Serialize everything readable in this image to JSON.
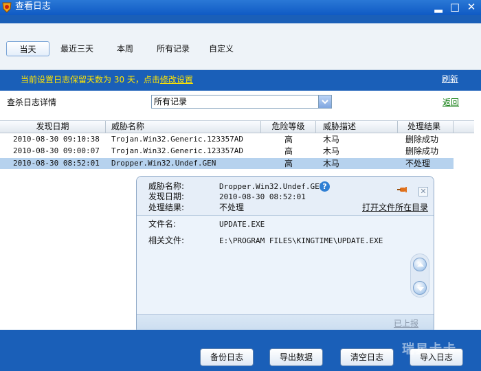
{
  "window": {
    "title": "查看日志",
    "minimize_glyph": "▂",
    "maximize_glyph": "□",
    "close_glyph": "✕"
  },
  "tabs": [
    {
      "label": "当天",
      "active": true
    },
    {
      "label": "最近三天",
      "active": false
    },
    {
      "label": "本周",
      "active": false
    },
    {
      "label": "所有记录",
      "active": false
    },
    {
      "label": "自定义",
      "active": false
    }
  ],
  "notice": {
    "text": "当前设置日志保留天数为 30 天，点击",
    "link": "修改设置",
    "color": "#ffe400"
  },
  "refresh_label": "刷新",
  "filter": {
    "label": "查杀日志详情",
    "selected": "所有记录"
  },
  "back_label": "返回",
  "table": {
    "columns": [
      "发现日期",
      "威胁名称",
      "危险等级",
      "威胁描述",
      "处理结果"
    ],
    "rows": [
      [
        "2010-08-30 09:10:38",
        "Trojan.Win32.Generic.123357AD",
        "高",
        "木马",
        "删除成功"
      ],
      [
        "2010-08-30 09:00:07",
        "Trojan.Win32.Generic.123357AD",
        "高",
        "木马",
        "删除成功"
      ],
      [
        "2010-08-30 08:52:01",
        "Dropper.Win32.Undef.GEN",
        "高",
        "木马",
        "不处理"
      ]
    ],
    "selected_row": 2
  },
  "detail": {
    "threat_name_label": "威胁名称:",
    "threat_name": "Dropper.Win32.Undef.GEN",
    "found_date_label": "发现日期:",
    "found_date": "2010-08-30 08:52:01",
    "result_label": "处理结果:",
    "result": "不处理",
    "open_dir_link": "打开文件所在目录",
    "file_name_label": "文件名:",
    "file_name": "UPDATE.EXE",
    "related_file_label": "相关文件:",
    "related_file": "E:\\PROGRAM FILES\\KINGTIME\\UPDATE.EXE",
    "reported_label": "已上报",
    "help_glyph": "?",
    "close_glyph": "✕"
  },
  "buttons": {
    "backup": "备份日志",
    "export": "导出数据",
    "clear": "清空日志",
    "import": "导入日志"
  },
  "watermark": "瑞星卡卡",
  "colors": {
    "frame_blue": "#1a5fb8",
    "selected_row": "#b6d2ee",
    "back_link": "#0a7a0a"
  }
}
